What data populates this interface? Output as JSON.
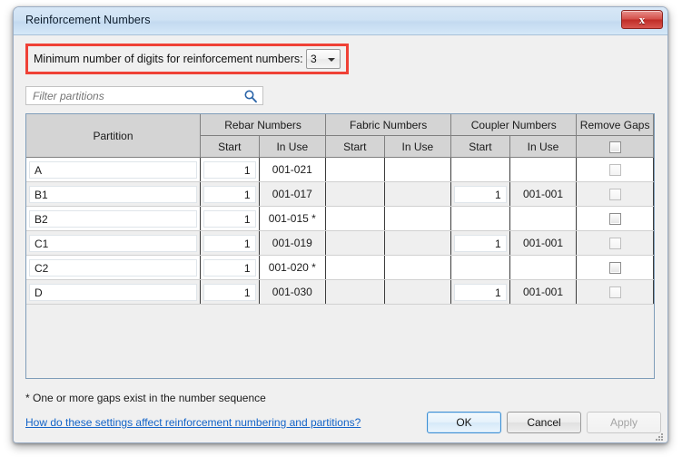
{
  "window": {
    "title": "Reinforcement Numbers",
    "close_label": "x"
  },
  "settings": {
    "min_digits_label": "Minimum number of digits for reinforcement numbers:",
    "min_digits_value": "3",
    "highlight_color": "#ef4136"
  },
  "filter": {
    "placeholder": "Filter partitions",
    "value": "",
    "icon": "search-icon"
  },
  "grid": {
    "group_headers": [
      {
        "label": "Partition",
        "span": 1,
        "rows": 2
      },
      {
        "label": "Rebar Numbers",
        "span": 2
      },
      {
        "label": "Fabric Numbers",
        "span": 2
      },
      {
        "label": "Coupler Numbers",
        "span": 2
      },
      {
        "label": "Remove Gaps",
        "span": 1
      }
    ],
    "sub_headers": [
      "Start",
      "In Use",
      "Start",
      "In Use",
      "Start",
      "In Use"
    ],
    "remove_gaps_header_checkbox": {
      "checked": false,
      "enabled": true
    },
    "rows": [
      {
        "partition": "A",
        "rebar_start": "1",
        "rebar_in_use": "001-021",
        "fabric_start": "",
        "fabric_in_use": "",
        "coupler_start": "",
        "coupler_in_use": "",
        "remove_gaps": {
          "checked": false,
          "enabled": false
        },
        "striped": false
      },
      {
        "partition": "B1",
        "rebar_start": "1",
        "rebar_in_use": "001-017",
        "fabric_start": "",
        "fabric_in_use": "",
        "coupler_start": "1",
        "coupler_in_use": "001-001",
        "remove_gaps": {
          "checked": false,
          "enabled": false
        },
        "striped": true
      },
      {
        "partition": "B2",
        "rebar_start": "1",
        "rebar_in_use": "001-015 *",
        "fabric_start": "",
        "fabric_in_use": "",
        "coupler_start": "",
        "coupler_in_use": "",
        "remove_gaps": {
          "checked": false,
          "enabled": true
        },
        "striped": false
      },
      {
        "partition": "C1",
        "rebar_start": "1",
        "rebar_in_use": "001-019",
        "fabric_start": "",
        "fabric_in_use": "",
        "coupler_start": "1",
        "coupler_in_use": "001-001",
        "remove_gaps": {
          "checked": false,
          "enabled": false
        },
        "striped": true
      },
      {
        "partition": "C2",
        "rebar_start": "1",
        "rebar_in_use": "001-020 *",
        "fabric_start": "",
        "fabric_in_use": "",
        "coupler_start": "",
        "coupler_in_use": "",
        "remove_gaps": {
          "checked": false,
          "enabled": true
        },
        "striped": false
      },
      {
        "partition": "D",
        "rebar_start": "1",
        "rebar_in_use": "001-030",
        "fabric_start": "",
        "fabric_in_use": "",
        "coupler_start": "1",
        "coupler_in_use": "001-001",
        "remove_gaps": {
          "checked": false,
          "enabled": false
        },
        "striped": true
      }
    ]
  },
  "footer": {
    "footnote": "* One or more gaps exist in the number sequence",
    "help_link": "How do these settings affect reinforcement numbering and partitions?",
    "buttons": {
      "ok": "OK",
      "cancel": "Cancel",
      "apply": "Apply"
    }
  }
}
